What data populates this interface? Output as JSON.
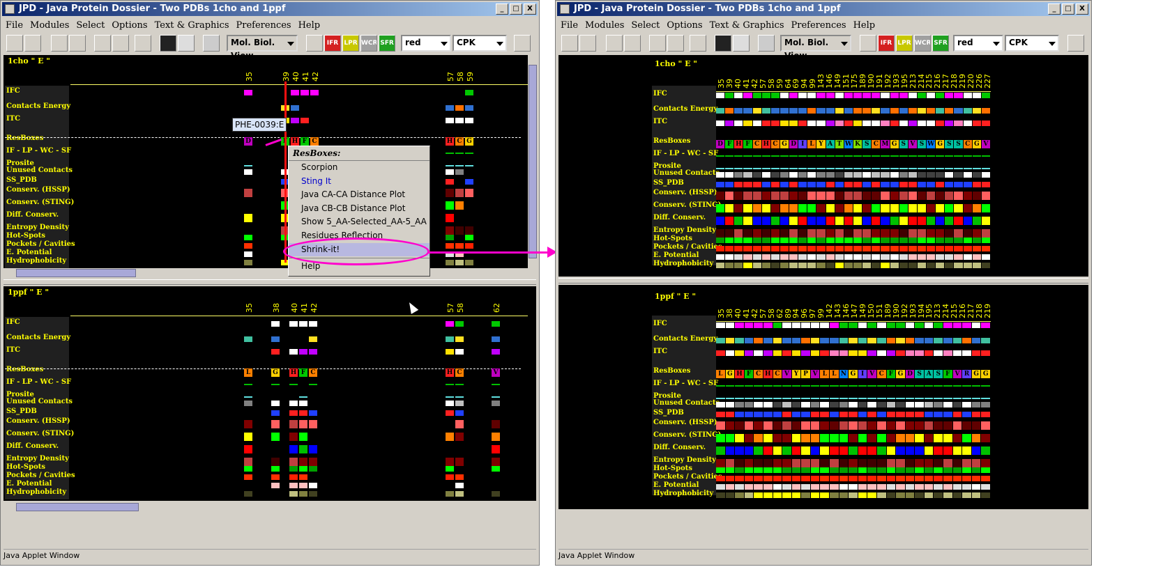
{
  "window": {
    "title": "JPD - Java Protein Dossier - Two PDBs 1cho and 1ppf",
    "buttons": [
      "_",
      "□",
      "X"
    ],
    "status": "Java Applet Window"
  },
  "menus": [
    "File",
    "Modules",
    "Select",
    "Options",
    "Text & Graphics",
    "Preferences",
    "Help"
  ],
  "toolbar": {
    "view_combo": "Mol. Biol. View",
    "color_combo": "red",
    "render_combo": "CPK",
    "buttons": [
      {
        "name": "print-icon",
        "label": ""
      },
      {
        "name": "refresh-icon",
        "label": ""
      },
      {
        "name": "eraser-icon",
        "label": ""
      },
      {
        "name": "grid-icon",
        "label": ""
      },
      {
        "name": "page-icon",
        "label": ""
      },
      {
        "name": "lock-icon",
        "label": ""
      },
      {
        "name": "structure-icon",
        "label": ""
      },
      {
        "name": "chart-icon",
        "label": ""
      },
      {
        "name": "no-chart-icon",
        "label": ""
      },
      {
        "name": "checkbox-list-icon",
        "label": ""
      },
      {
        "name": "magnifier-icon",
        "label": ""
      },
      {
        "name": "ifr-icon",
        "label": "IFR",
        "color": "#d42020"
      },
      {
        "name": "lpr-icon",
        "label": "LPR",
        "color": "#c8c800"
      },
      {
        "name": "wc-icon",
        "label": "WCR",
        "color": "#a0a0a0"
      },
      {
        "name": "sfr-icon",
        "label": "SFR",
        "color": "#20a020"
      },
      {
        "name": "book-icon",
        "label": ""
      }
    ]
  },
  "track_labels": [
    "IFC",
    "Contacts Energy",
    "ITC",
    "ResBoxes",
    "IF - LP - WC - SF",
    "Prosite",
    "Unused Contacts",
    "SS_PDB",
    "Conserv. (HSSP)",
    "Conserv. (STING)",
    "Diff. Conserv.",
    "Entropy Density",
    "Hot-Spots",
    "Pockets / Cavities",
    "E. Potential",
    "Hydrophobicity"
  ],
  "left": {
    "top_panel": {
      "title": "1cho \" E \"",
      "numbers": [
        "35",
        "39",
        "40",
        "41",
        "42",
        "57",
        "58",
        "59"
      ],
      "residues": [
        "D",
        "F",
        "H",
        "F",
        "C",
        "H",
        "C",
        "G"
      ]
    },
    "bottom_panel": {
      "title": "1ppf \" E \"",
      "numbers": [
        "35",
        "38",
        "40",
        "41",
        "42",
        "57",
        "58",
        "62"
      ],
      "residues": [
        "L",
        "G",
        "H",
        "F",
        "C",
        "H",
        "C",
        "V"
      ]
    },
    "tooltip": "PHE-0039:E",
    "popup": {
      "header": "ResBoxes:",
      "items": [
        "Scorpion",
        "Sting It",
        "Java CA-CA Distance Plot",
        "Java CB-CB Distance Plot",
        "Show 5_AA-Selected_AA-5_AA",
        "Residues Reflection",
        "Shrink-it!",
        "Help"
      ]
    }
  },
  "right": {
    "top_panel": {
      "title": "1cho \" E \"",
      "numbers": [
        "35",
        "39",
        "40",
        "41",
        "42",
        "57",
        "58",
        "59",
        "64",
        "69",
        "94",
        "99",
        "143",
        "146",
        "149",
        "151",
        "175",
        "189",
        "190",
        "191",
        "192",
        "193",
        "195",
        "213",
        "214",
        "215",
        "216",
        "217",
        "218",
        "219",
        "220",
        "226",
        "227"
      ],
      "residues": [
        "D",
        "F",
        "H",
        "F",
        "C",
        "H",
        "C",
        "G",
        "D",
        "I",
        "L",
        "Y",
        "A",
        "T",
        "W",
        "K",
        "S",
        "C",
        "M",
        "G",
        "S",
        "V",
        "S",
        "W",
        "G",
        "S",
        "S",
        "C",
        "G",
        "V"
      ]
    },
    "bottom_panel": {
      "title": "1ppf \" E \"",
      "numbers": [
        "35",
        "38",
        "40",
        "41",
        "42",
        "57",
        "58",
        "62",
        "89",
        "94",
        "96",
        "97",
        "99",
        "142",
        "143",
        "146",
        "147",
        "149",
        "150",
        "151",
        "189",
        "190",
        "192",
        "193",
        "194",
        "195",
        "213",
        "214",
        "215",
        "216",
        "217",
        "218",
        "219"
      ],
      "residues": [
        "L",
        "G",
        "H",
        "F",
        "C",
        "H",
        "C",
        "V",
        "Y",
        "P",
        "V",
        "L",
        "L",
        "N",
        "G",
        "I",
        "V",
        "C",
        "F",
        "G",
        "D",
        "S",
        "A",
        "S",
        "F",
        "V",
        "R",
        "G",
        "G"
      ]
    }
  },
  "colors": {
    "title_start": "#0a246a",
    "title_end": "#a6caf0",
    "label_yellow": "#ffff00",
    "annotation_magenta": "#ff00cc"
  }
}
